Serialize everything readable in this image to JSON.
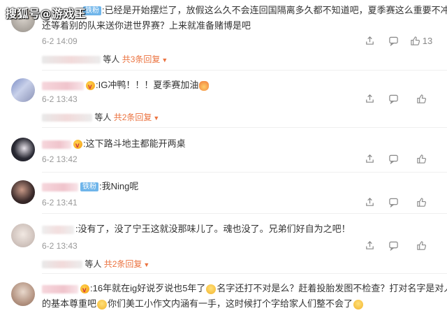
{
  "watermark": "搜狐号@游戏王",
  "icons": {
    "share": "share-icon",
    "comment": "comment-icon",
    "like": "like-icon",
    "vip": "vip-badge-icon"
  },
  "colors": {
    "accent": "#eb7340",
    "badge": "#6fb5ea",
    "meta": "#999999"
  },
  "comments": [
    {
      "badge": "铁粉",
      "text1": ":已经是开始摆烂了，放假这么久不会连回国隔离多久都不知道吧，夏季赛这么重要不冲",
      "text2": "还等着别的队来送你进世界赛？上来就准备赌博是吧",
      "date": "6-2 14:09",
      "likes": "13",
      "replies_suffix": "等人",
      "replies_total": "共3条回复"
    },
    {
      "text1a": ":IG冲鸭！！！夏季赛加油",
      "date": "6-2 13:43",
      "replies_suffix": "等人",
      "replies_total": "共2条回复"
    },
    {
      "text1": ":这下路斗地主都能开两桌",
      "date": "6-2 13:42"
    },
    {
      "badge": "铁粉",
      "text1": ":我Ning呢",
      "date": "6-2 13:41"
    },
    {
      "text1": ":没有了，没了宁王这就没那味儿了。魂也没了。兄弟们好自为之吧！",
      "date": "6-2 13:43",
      "replies_suffix": "等人",
      "replies_total": "共2条回复"
    },
    {
      "text1a": ":16年就在ig好说歹说也5年了",
      "text1b": "名字还打不对是么？赶着投胎发图不检查？打对名字是对人",
      "text2a": "的基本尊重吧",
      "text2b": "你们美工小作文内涵有一手，这时候打个字给家人们整不会了"
    }
  ]
}
